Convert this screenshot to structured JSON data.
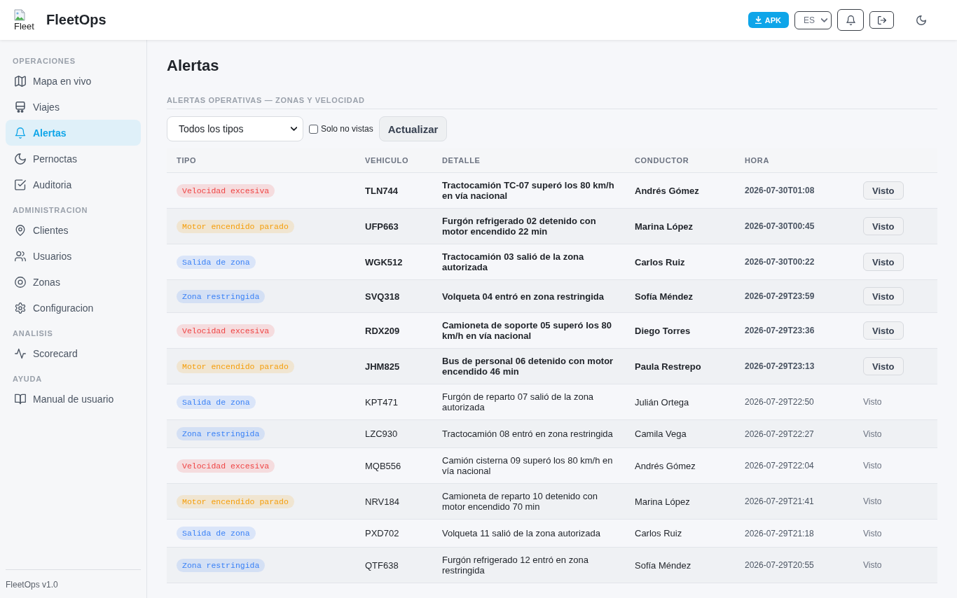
{
  "header": {
    "logo_alt": "Fleet",
    "title": "FleetOps",
    "apk_button": "APK",
    "language": "ES"
  },
  "sidebar": {
    "sections": [
      {
        "label": "OPERACIONES",
        "items": [
          {
            "label": "Mapa en vivo",
            "selected": false
          },
          {
            "label": "Viajes",
            "selected": false
          },
          {
            "label": "Alertas",
            "selected": true
          },
          {
            "label": "Pernoctas",
            "selected": false
          },
          {
            "label": "Auditoria",
            "selected": false
          }
        ]
      },
      {
        "label": "ADMINISTRACION",
        "items": [
          {
            "label": "Clientes",
            "selected": false
          },
          {
            "label": "Usuarios",
            "selected": false
          },
          {
            "label": "Zonas",
            "selected": false
          },
          {
            "label": "Configuracion",
            "selected": false
          }
        ]
      },
      {
        "label": "ANALISIS",
        "items": [
          {
            "label": "Scorecard",
            "selected": false
          }
        ]
      },
      {
        "label": "AYUDA",
        "items": [
          {
            "label": "Manual de usuario",
            "selected": false
          }
        ]
      }
    ],
    "footer": "FleetOps v1.0"
  },
  "page_title": "Alertas",
  "section_label": "ALERTAS OPERATIVAS — ZONAS Y VELOCIDAD",
  "filters": {
    "type_select": "Todos los tipos",
    "only_unseen": {
      "label": "Solo no vistas",
      "checked": false
    },
    "refresh_button": "Actualizar"
  },
  "table": {
    "columns": [
      "TIPO",
      "VEHICULO",
      "DETALLE",
      "CONDUCTOR",
      "HORA"
    ],
    "rows": [
      {
        "tag": {
          "label": "Velocidad excesiva",
          "color": "#ef4444"
        },
        "vehicle": "TLN744",
        "detail": "Tractocamión TC-07 superó los 80 km/h en vía nacional",
        "driver": "Andrés Gómez",
        "time": "2026-07-30T01:08",
        "action": "Visto",
        "seen": false
      },
      {
        "tag": {
          "label": "Motor encendido parado",
          "color": "#f59e0b"
        },
        "vehicle": "UFP663",
        "detail": "Furgón refrigerado 02 detenido con motor encendido 22 min",
        "driver": "Marina López",
        "time": "2026-07-30T00:45",
        "action": "Visto",
        "seen": false
      },
      {
        "tag": {
          "label": "Salida de zona",
          "color": "#3b82f6"
        },
        "vehicle": "WGK512",
        "detail": "Tractocamión 03 salió de la zona autorizada",
        "driver": "Carlos Ruiz",
        "time": "2026-07-30T00:22",
        "action": "Visto",
        "seen": false
      },
      {
        "tag": {
          "label": "Zona restringida",
          "color": "#3b82f6"
        },
        "vehicle": "SVQ318",
        "detail": "Volqueta 04 entró en zona restringida",
        "driver": "Sofía Méndez",
        "time": "2026-07-29T23:59",
        "action": "Visto",
        "seen": false
      },
      {
        "tag": {
          "label": "Velocidad excesiva",
          "color": "#ef4444"
        },
        "vehicle": "RDX209",
        "detail": "Camioneta de soporte 05 superó los 80 km/h en vía nacional",
        "driver": "Diego Torres",
        "time": "2026-07-29T23:36",
        "action": "Visto",
        "seen": false
      },
      {
        "tag": {
          "label": "Motor encendido parado",
          "color": "#f59e0b"
        },
        "vehicle": "JHM825",
        "detail": "Bus de personal 06 detenido con motor encendido 46 min",
        "driver": "Paula Restrepo",
        "time": "2026-07-29T23:13",
        "action": "Visto",
        "seen": false
      },
      {
        "tag": {
          "label": "Salida de zona",
          "color": "#3b82f6"
        },
        "vehicle": "KPT471",
        "detail": "Furgón de reparto 07 salió de la zona autorizada",
        "driver": "Julián Ortega",
        "time": "2026-07-29T22:50",
        "action": "Visto",
        "seen": true
      },
      {
        "tag": {
          "label": "Zona restringida",
          "color": "#3b82f6"
        },
        "vehicle": "LZC930",
        "detail": "Tractocamión 08 entró en zona restringida",
        "driver": "Camila Vega",
        "time": "2026-07-29T22:27",
        "action": "Visto",
        "seen": true
      },
      {
        "tag": {
          "label": "Velocidad excesiva",
          "color": "#ef4444"
        },
        "vehicle": "MQB556",
        "detail": "Camión cisterna 09 superó los 80 km/h en vía nacional",
        "driver": "Andrés Gómez",
        "time": "2026-07-29T22:04",
        "action": "Visto",
        "seen": true
      },
      {
        "tag": {
          "label": "Motor encendido parado",
          "color": "#f59e0b"
        },
        "vehicle": "NRV184",
        "detail": "Camioneta de reparto 10 detenido con motor encendido 70 min",
        "driver": "Marina López",
        "time": "2026-07-29T21:41",
        "action": "Visto",
        "seen": true
      },
      {
        "tag": {
          "label": "Salida de zona",
          "color": "#3b82f6"
        },
        "vehicle": "PXD702",
        "detail": "Volqueta 11 salió de la zona autorizada",
        "driver": "Carlos Ruiz",
        "time": "2026-07-29T21:18",
        "action": "Visto",
        "seen": true
      },
      {
        "tag": {
          "label": "Zona restringida",
          "color": "#3b82f6"
        },
        "vehicle": "QTF638",
        "detail": "Furgón refrigerado 12 entró en zona restringida",
        "driver": "Sofía Méndez",
        "time": "2026-07-29T20:55",
        "action": "Visto",
        "seen": true
      }
    ]
  }
}
